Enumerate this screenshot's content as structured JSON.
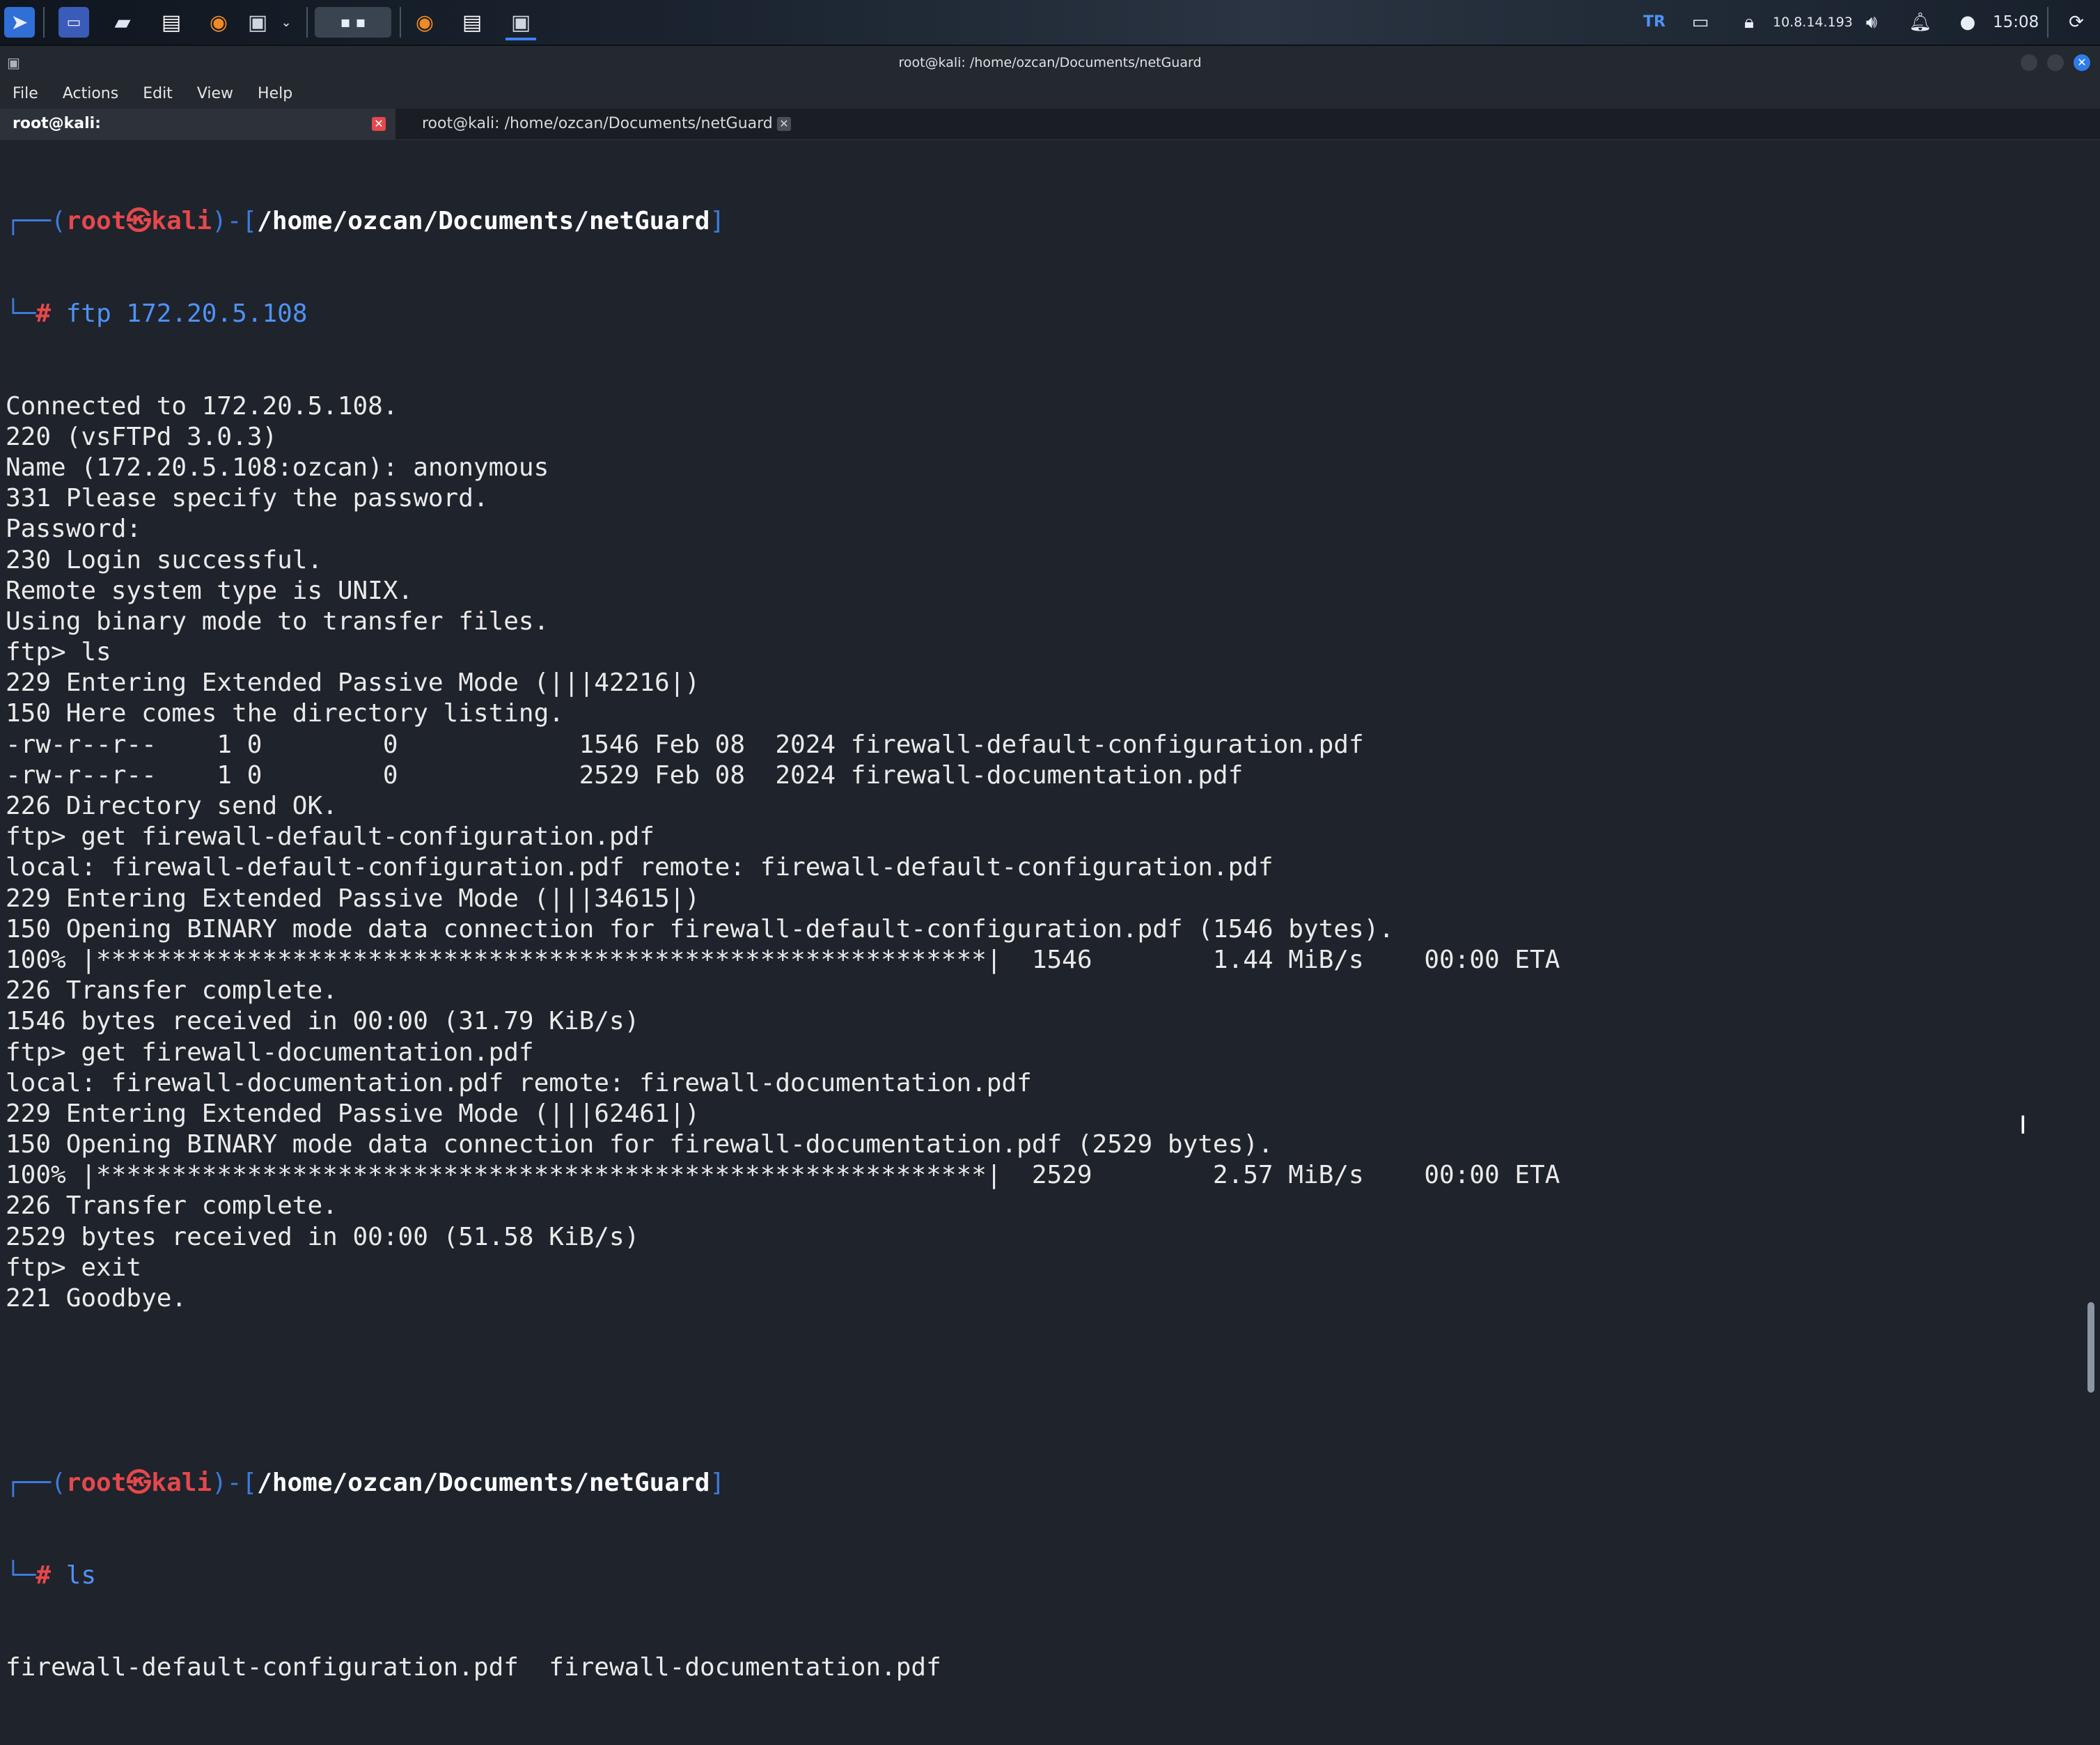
{
  "taskbar": {
    "keyboard_layout": "TR",
    "ip": "10.8.14.193",
    "clock": "15:08"
  },
  "window": {
    "title": "root@kali: /home/ozcan/Documents/netGuard"
  },
  "menu": [
    "File",
    "Actions",
    "Edit",
    "View",
    "Help"
  ],
  "tabs": [
    {
      "label": "root@kali: /home/ozcan/Documents/netGuard",
      "active": true
    },
    {
      "label": "root@kali: /home/ozcan/Documents/netGuard",
      "active": false
    }
  ],
  "prompt": {
    "corner_top": "┌──(",
    "user": "root",
    "at": "㉿",
    "host": "kali",
    "mid": ")-[",
    "path": "/home/ozcan/Documents/netGuard",
    "end": "]",
    "corner_bottom": "└─",
    "hash": "#"
  },
  "session1": {
    "command": "ftp 172.20.5.108",
    "output": [
      "Connected to 172.20.5.108.",
      "220 (vsFTPd 3.0.3)",
      "Name (172.20.5.108:ozcan): anonymous",
      "331 Please specify the password.",
      "Password:",
      "230 Login successful.",
      "Remote system type is UNIX.",
      "Using binary mode to transfer files.",
      "ftp> ls",
      "229 Entering Extended Passive Mode (|||42216|)",
      "150 Here comes the directory listing.",
      "-rw-r--r--    1 0        0            1546 Feb 08  2024 firewall-default-configuration.pdf",
      "-rw-r--r--    1 0        0            2529 Feb 08  2024 firewall-documentation.pdf",
      "226 Directory send OK.",
      "ftp> get firewall-default-configuration.pdf",
      "local: firewall-default-configuration.pdf remote: firewall-default-configuration.pdf",
      "229 Entering Extended Passive Mode (|||34615|)",
      "150 Opening BINARY mode data connection for firewall-default-configuration.pdf (1546 bytes).",
      "100% |***********************************************************|  1546        1.44 MiB/s    00:00 ETA",
      "226 Transfer complete.",
      "1546 bytes received in 00:00 (31.79 KiB/s)",
      "ftp> get firewall-documentation.pdf",
      "local: firewall-documentation.pdf remote: firewall-documentation.pdf",
      "229 Entering Extended Passive Mode (|||62461|)",
      "150 Opening BINARY mode data connection for firewall-documentation.pdf (2529 bytes).",
      "100% |***********************************************************|  2529        2.57 MiB/s    00:00 ETA",
      "226 Transfer complete.",
      "2529 bytes received in 00:00 (51.58 KiB/s)",
      "ftp> exit",
      "221 Goodbye."
    ]
  },
  "session2": {
    "command": "ls",
    "output": [
      "firewall-default-configuration.pdf  firewall-documentation.pdf"
    ]
  },
  "colors": {
    "prompt_frame": "#3b7bdc",
    "prompt_user": "#e5484d",
    "command": "#4f92f7",
    "background": "#1f232b"
  }
}
